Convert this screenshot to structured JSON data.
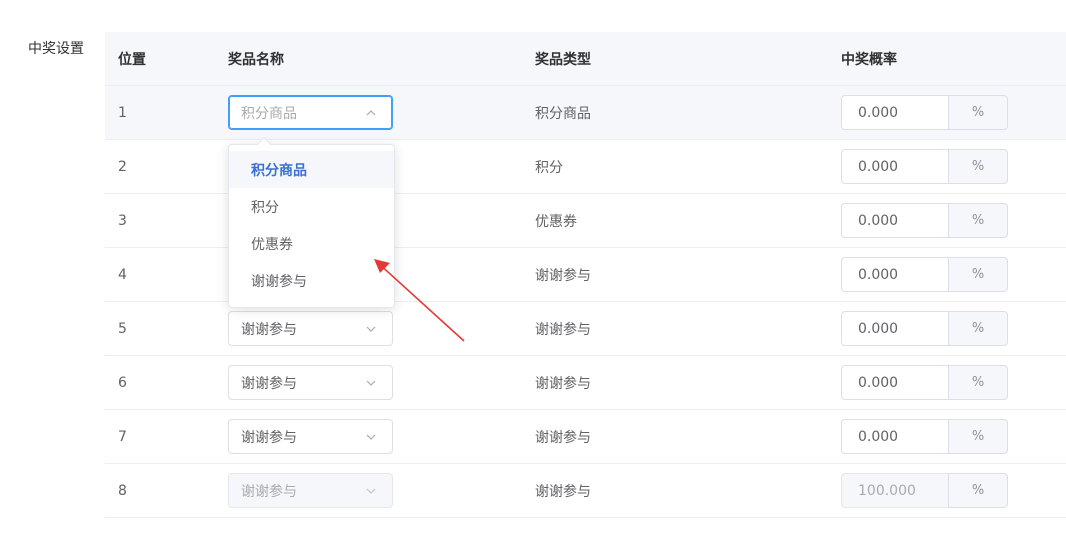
{
  "section_label": "中奖设置",
  "table": {
    "headers": {
      "position": "位置",
      "prize_name": "奖品名称",
      "prize_type": "奖品类型",
      "probability": "中奖概率"
    },
    "percent_suffix": "%",
    "rows": [
      {
        "position": "1",
        "prize_name": "积分商品",
        "prize_type": "积分商品",
        "probability": "0.000"
      },
      {
        "position": "2",
        "prize_name": "积分",
        "prize_type": "积分",
        "probability": "0.000"
      },
      {
        "position": "3",
        "prize_name": "优惠券",
        "prize_type": "优惠券",
        "probability": "0.000"
      },
      {
        "position": "4",
        "prize_name": "谢谢参与",
        "prize_type": "谢谢参与",
        "probability": "0.000"
      },
      {
        "position": "5",
        "prize_name": "谢谢参与",
        "prize_type": "谢谢参与",
        "probability": "0.000"
      },
      {
        "position": "6",
        "prize_name": "谢谢参与",
        "prize_type": "谢谢参与",
        "probability": "0.000"
      },
      {
        "position": "7",
        "prize_name": "谢谢参与",
        "prize_type": "谢谢参与",
        "probability": "0.000"
      },
      {
        "position": "8",
        "prize_name": "谢谢参与",
        "prize_type": "谢谢参与",
        "probability": "100.000"
      }
    ]
  },
  "dropdown": {
    "options": [
      "积分商品",
      "积分",
      "优惠券",
      "谢谢参与"
    ],
    "selected": "积分商品"
  },
  "colors": {
    "accent": "#409eff",
    "selected_option": "#3a6fd8",
    "annotation_arrow": "#e53935"
  }
}
